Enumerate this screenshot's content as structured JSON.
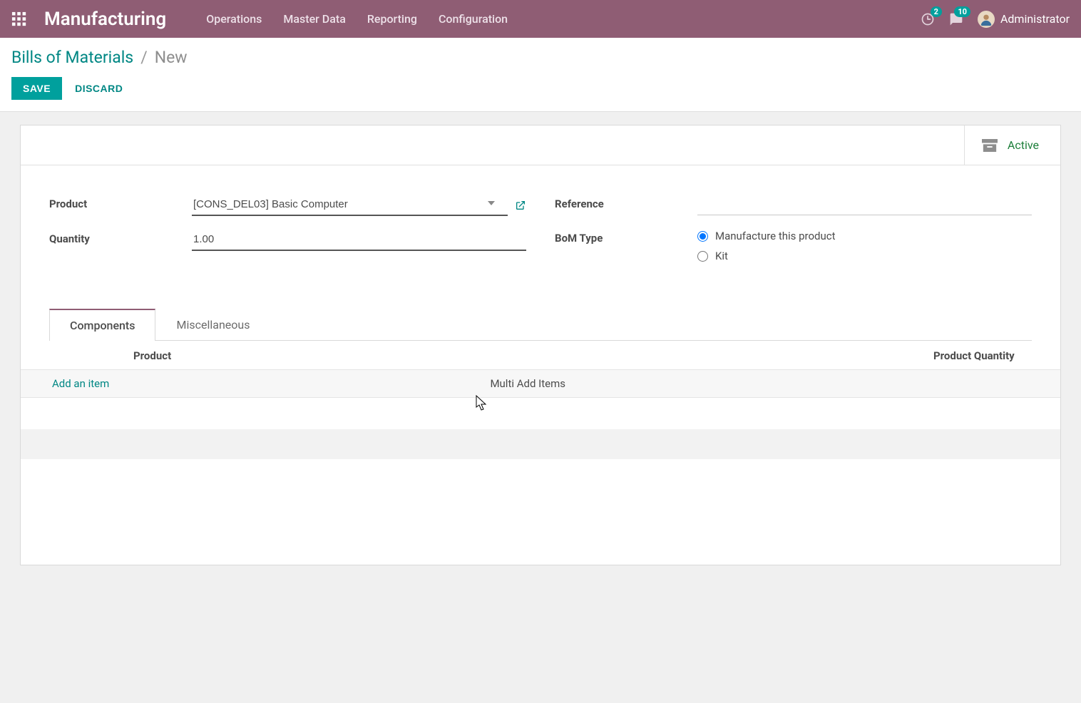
{
  "topbar": {
    "brand": "Manufacturing",
    "menu": [
      "Operations",
      "Master Data",
      "Reporting",
      "Configuration"
    ],
    "activity_count": "2",
    "messages_count": "10",
    "user": "Administrator"
  },
  "breadcrumb": {
    "parent": "Bills of Materials",
    "sep": "/",
    "current": "New"
  },
  "actions": {
    "save": "SAVE",
    "discard": "DISCARD"
  },
  "status": {
    "active": "Active"
  },
  "form": {
    "product_label": "Product",
    "product_value": "[CONS_DEL03] Basic Computer",
    "quantity_label": "Quantity",
    "quantity_value": "1.00",
    "reference_label": "Reference",
    "reference_value": "",
    "bom_type_label": "BoM Type",
    "bom_option_manufacture": "Manufacture this product",
    "bom_option_kit": "Kit"
  },
  "tabs": {
    "components": "Components",
    "misc": "Miscellaneous"
  },
  "table": {
    "col_product": "Product",
    "col_qty": "Product Quantity",
    "add_item": "Add an item",
    "multi_add": "Multi Add Items"
  }
}
